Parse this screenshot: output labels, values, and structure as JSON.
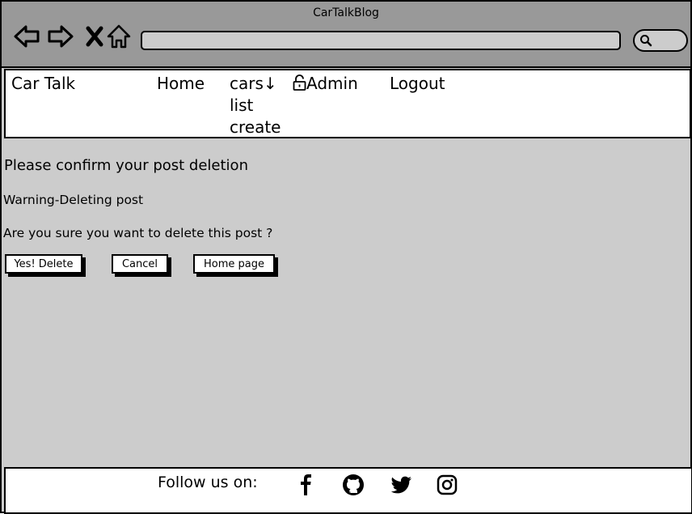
{
  "window": {
    "title": "CarTalkBlog"
  },
  "navbar": {
    "brand": "Car Talk",
    "home": "Home",
    "cars": "cars",
    "cars_arrow": "↓",
    "cars_list": "list",
    "cars_create": "create",
    "admin": "Admin",
    "logout": "Logout"
  },
  "main": {
    "heading": "Please confirm your post deletion",
    "warning": "Warning-Deleting post",
    "question": "Are you sure you want to delete this post ?",
    "buttons": {
      "delete": "Yes! Delete",
      "cancel": "Cancel",
      "home": "Home page"
    }
  },
  "footer": {
    "follow": "Follow us on:",
    "icons": [
      "facebook-icon",
      "github-icon",
      "twitter-icon",
      "instagram-icon"
    ]
  },
  "colors": {
    "chrome": "#999999",
    "page_background": "#cccccc",
    "panel": "#ffffff",
    "ink": "#000000"
  }
}
